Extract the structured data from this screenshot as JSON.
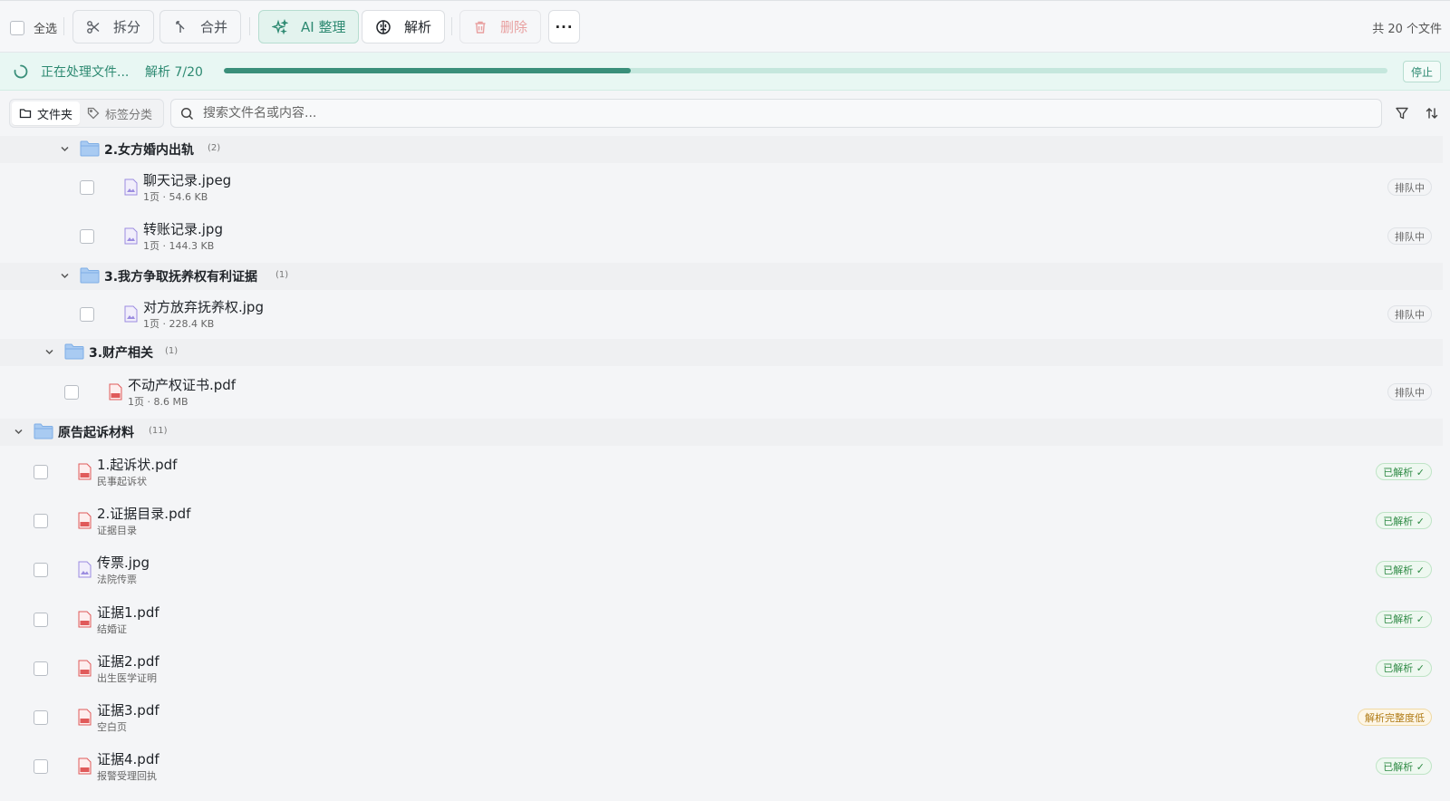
{
  "toolbar": {
    "select_all": "全选",
    "split": "拆分",
    "merge": "合并",
    "ai_organize": "AI 整理",
    "parse": "解析",
    "delete": "删除",
    "more": "···",
    "file_count": "共 20 个文件"
  },
  "progress": {
    "status": "正在处理文件...",
    "count": "解析 7/20",
    "fraction": 0.35,
    "stop": "停止"
  },
  "view_tabs": [
    {
      "label": "文件夹",
      "active": true
    },
    {
      "label": "标签分类",
      "active": false
    }
  ],
  "search": {
    "placeholder": "搜索文件名或内容..."
  },
  "tree": {
    "folder_girl": {
      "name": "2.女方婚内出轨",
      "count": "(2)"
    },
    "file_chat": {
      "name": "聊天记录.jpeg",
      "meta": "1页 · 54.6 KB",
      "status": "排队中"
    },
    "file_transfer": {
      "name": "转账记录.jpg",
      "meta": "1页 · 144.3 KB",
      "status": "排队中"
    },
    "folder_custody": {
      "name": "3.我方争取抚养权有利证据",
      "count": "(1)"
    },
    "file_custody": {
      "name": "对方放弃抚养权.jpg",
      "meta": "1页 · 228.4 KB",
      "status": "排队中"
    },
    "folder_property": {
      "name": "3.财产相关",
      "count": "(1)"
    },
    "file_deed": {
      "name": "不动产权证书.pdf",
      "meta": "1页 · 8.6 MB",
      "status": "排队中"
    },
    "folder_plaintiff": {
      "name": "原告起诉材料",
      "count": "(11)"
    },
    "plaintiff_files": [
      {
        "name": "1.起诉状.pdf",
        "sub": "民事起诉状",
        "status": "已解析 ✓",
        "kind": "pdf",
        "state": "done"
      },
      {
        "name": "2.证据目录.pdf",
        "sub": "证据目录",
        "status": "已解析 ✓",
        "kind": "pdf",
        "state": "done"
      },
      {
        "name": "传票.jpg",
        "sub": "法院传票",
        "status": "已解析 ✓",
        "kind": "img",
        "state": "done"
      },
      {
        "name": "证据1.pdf",
        "sub": "结婚证",
        "status": "已解析 ✓",
        "kind": "pdf",
        "state": "done"
      },
      {
        "name": "证据2.pdf",
        "sub": "出生医学证明",
        "status": "已解析 ✓",
        "kind": "pdf",
        "state": "done"
      },
      {
        "name": "证据3.pdf",
        "sub": "空白页",
        "status": "解析完整度低",
        "kind": "pdf",
        "state": "low"
      },
      {
        "name": "证据4.pdf",
        "sub": "报警受理回执",
        "status": "已解析 ✓",
        "kind": "pdf",
        "state": "done"
      }
    ]
  },
  "colors": {
    "accent": "#3a8f7a",
    "pdf": "#e05a5a",
    "image": "#9b8ce0",
    "folder": "#8fb9ec"
  }
}
